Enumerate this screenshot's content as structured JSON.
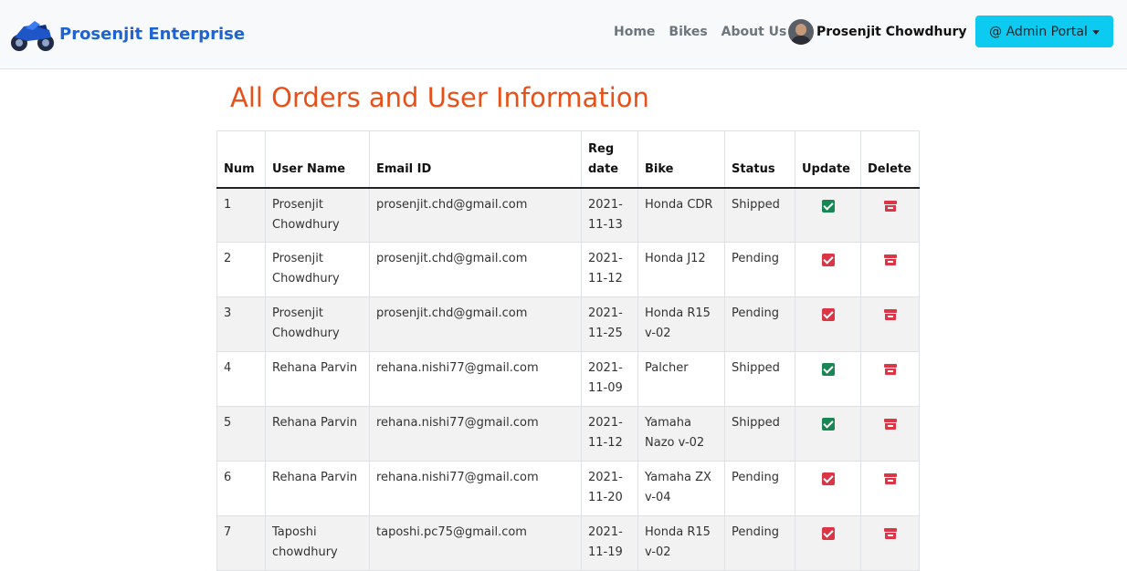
{
  "nav": {
    "brand": "Prosenjit Enterprise",
    "links": [
      "Home",
      "Bikes",
      "About Us"
    ],
    "user_name": "Prosenjit Chowdhury",
    "admin_button": "@ Admin Portal"
  },
  "page": {
    "title": "All Orders and User Information"
  },
  "table": {
    "headers": {
      "num": "Num",
      "user": "User Name",
      "email": "Email ID",
      "reg_line1": "Reg",
      "reg_line2": "date",
      "bike": "Bike",
      "status": "Status",
      "update": "Update",
      "delete": "Delete"
    },
    "rows": [
      {
        "num": "1",
        "user": "Prosenjit Chowdhury",
        "email": "prosenjit.chd@gmail.com",
        "date": "2021-11-13",
        "bike": "Honda CDR",
        "status": "Shipped"
      },
      {
        "num": "2",
        "user": "Prosenjit Chowdhury",
        "email": "prosenjit.chd@gmail.com",
        "date": "2021-11-12",
        "bike": "Honda J12",
        "status": "Pending"
      },
      {
        "num": "3",
        "user": "Prosenjit Chowdhury",
        "email": "prosenjit.chd@gmail.com",
        "date": "2021-11-25",
        "bike": "Honda R15 v-02",
        "status": "Pending"
      },
      {
        "num": "4",
        "user": "Rehana Parvin",
        "email": "rehana.nishi77@gmail.com",
        "date": "2021-11-09",
        "bike": "Palcher",
        "status": "Shipped"
      },
      {
        "num": "5",
        "user": "Rehana Parvin",
        "email": "rehana.nishi77@gmail.com",
        "date": "2021-11-12",
        "bike": "Yamaha Nazo v-02",
        "status": "Shipped"
      },
      {
        "num": "6",
        "user": "Rehana Parvin",
        "email": "rehana.nishi77@gmail.com",
        "date": "2021-11-20",
        "bike": "Yamaha ZX v-04",
        "status": "Pending"
      },
      {
        "num": "7",
        "user": "Taposhi chowdhury",
        "email": "taposhi.pc75@gmail.com",
        "date": "2021-11-19",
        "bike": "Honda R15 v-02",
        "status": "Pending"
      }
    ]
  },
  "colors": {
    "brand": "#1e63d4",
    "title": "#e8501a",
    "admin_button_bg": "#0dcaf0",
    "shipped": "#2f6fde",
    "pending": "#6c757d",
    "check_green": "#198754",
    "check_red": "#dc3545"
  },
  "icons": {
    "logo": "motorbike-logo-icon",
    "update_shipped": "green-check-square-icon",
    "update_pending": "red-check-square-icon",
    "delete": "trash-icon"
  }
}
